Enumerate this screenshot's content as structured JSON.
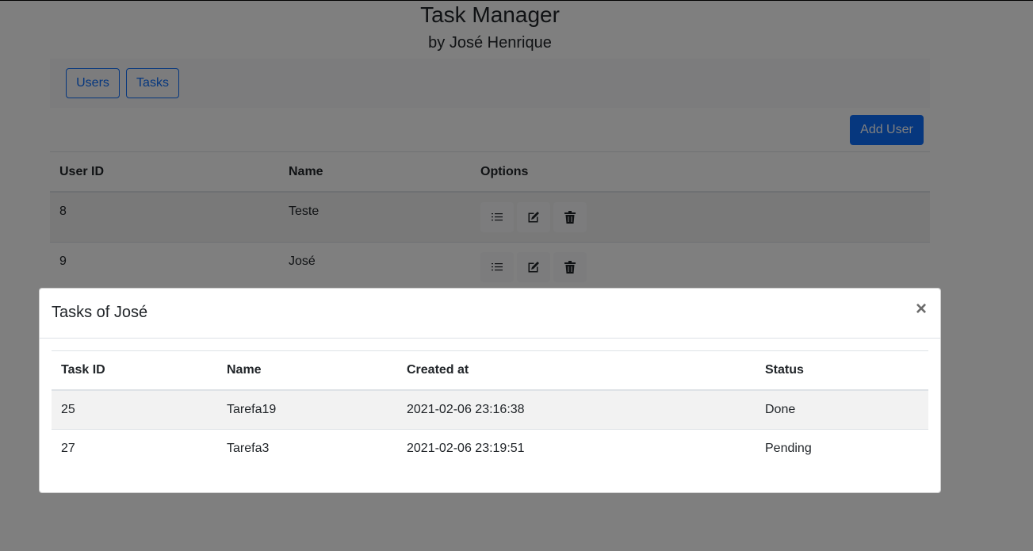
{
  "app": {
    "title": "Task Manager",
    "subtitle": "by José Henrique"
  },
  "nav": {
    "users_label": "Users",
    "tasks_label": "Tasks"
  },
  "actions": {
    "add_user_label": "Add User"
  },
  "users_table": {
    "headers": [
      "User ID",
      "Name",
      "Options"
    ],
    "rows": [
      {
        "id": "8",
        "name": "Teste"
      },
      {
        "id": "9",
        "name": "José"
      }
    ],
    "option_icons": [
      "list-icon",
      "edit-icon",
      "trash-icon"
    ]
  },
  "modal": {
    "title": "Tasks of José",
    "close_label": "×",
    "headers": [
      "Task ID",
      "Name",
      "Created at",
      "Status"
    ],
    "rows": [
      {
        "id": "25",
        "name": "Tarefa19",
        "created_at": "2021-02-06 23:16:38",
        "status": "Done"
      },
      {
        "id": "27",
        "name": "Tarefa3",
        "created_at": "2021-02-06 23:19:51",
        "status": "Pending"
      }
    ]
  },
  "colors": {
    "primary": "#0d6efd",
    "backdrop": "rgba(0,0,0,0.5)",
    "stripe": "#f2f2f2"
  }
}
